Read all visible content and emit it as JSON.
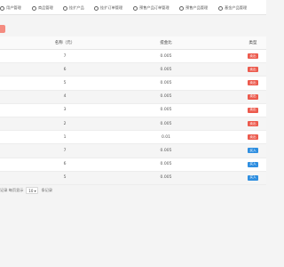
{
  "nav": {
    "items": [
      {
        "label": "用户管理"
      },
      {
        "label": "商品管理"
      },
      {
        "label": "挂扩产品"
      },
      {
        "label": "挂扩订单管理"
      },
      {
        "label": "预售产品订单管理"
      },
      {
        "label": "预售产品管理"
      },
      {
        "label": "基金产品管理"
      }
    ]
  },
  "table": {
    "headers": {
      "name": "名称（元）",
      "ratio": "提金比",
      "type": "类型"
    },
    "rows": [
      {
        "name": "7",
        "ratio": "0.005",
        "type": "卖出",
        "kind": "out"
      },
      {
        "name": "6",
        "ratio": "0.005",
        "type": "卖出",
        "kind": "out"
      },
      {
        "name": "5",
        "ratio": "0.005",
        "type": "卖出",
        "kind": "out"
      },
      {
        "name": "4",
        "ratio": "0.005",
        "type": "卖出",
        "kind": "out"
      },
      {
        "name": "3",
        "ratio": "0.005",
        "type": "卖出",
        "kind": "out"
      },
      {
        "name": "2",
        "ratio": "0.005",
        "type": "卖出",
        "kind": "out"
      },
      {
        "name": "1",
        "ratio": "0.01",
        "type": "卖出",
        "kind": "out"
      },
      {
        "name": "7",
        "ratio": "0.005",
        "type": "买入",
        "kind": "in"
      },
      {
        "name": "6",
        "ratio": "0.005",
        "type": "买入",
        "kind": "in"
      },
      {
        "name": "5",
        "ratio": "0.005",
        "type": "买入",
        "kind": "in"
      }
    ]
  },
  "pager": {
    "prefix": "记录 每页显示",
    "page_size": "10 ▾",
    "suffix": "条记录"
  },
  "colors": {
    "accent": "#f48b80",
    "tag_out": "#ec5a4d",
    "tag_in": "#2e8ee0"
  }
}
